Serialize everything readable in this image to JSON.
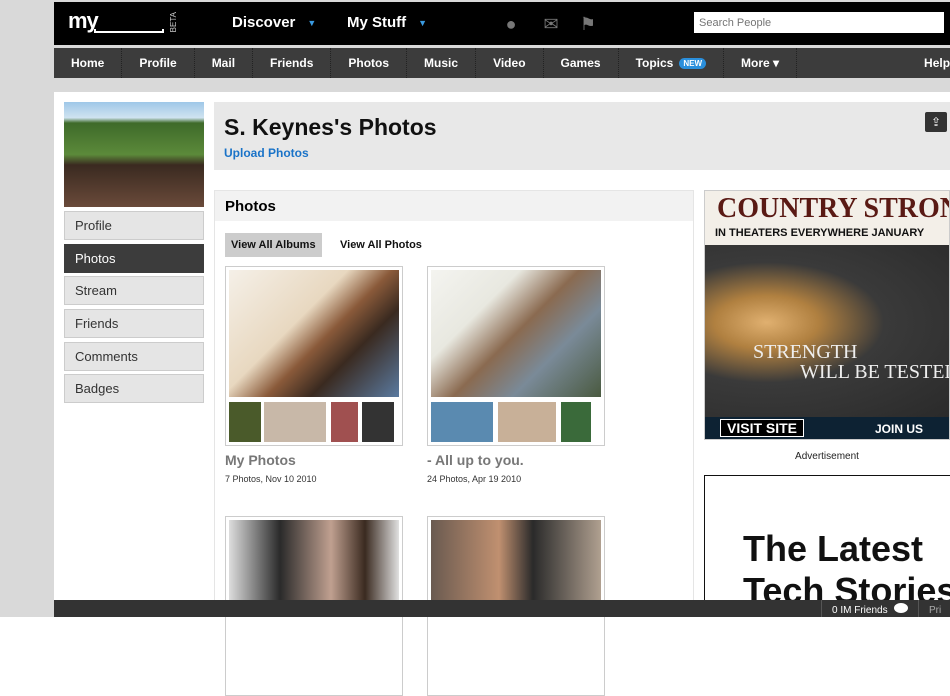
{
  "topbar": {
    "logo": "my",
    "beta": "BETA",
    "discover": "Discover",
    "my_stuff": "My Stuff",
    "search_placeholder": "Search People"
  },
  "nav": {
    "items": [
      "Home",
      "Profile",
      "Mail",
      "Friends",
      "Photos",
      "Music",
      "Video",
      "Games",
      "Topics",
      "More ▾"
    ],
    "new_badge": "NEW",
    "help": "Help"
  },
  "sidebar": {
    "items": [
      "Profile",
      "Photos",
      "Stream",
      "Friends",
      "Comments",
      "Badges"
    ],
    "active": "Photos"
  },
  "header": {
    "title": "S. Keynes's Photos",
    "upload": "Upload Photos"
  },
  "panel": {
    "title": "Photos",
    "tabs": [
      "View All Albums",
      "View All Photos"
    ],
    "albums": [
      {
        "title": "My Photos",
        "meta": "7 Photos, Nov 10 2010"
      },
      {
        "title": "- All up to you.",
        "meta": "24 Photos, Apr 19 2010"
      }
    ]
  },
  "ad1": {
    "line1": "COUNTRY STRONG",
    "line2": "IN THEATERS EVERYWHERE JANUARY",
    "line3": "STRENGTH",
    "line4": "WILL BE TESTED",
    "visit": "VISIT SITE",
    "join": "JOIN US"
  },
  "ad_label": "Advertisement",
  "ad2": {
    "line1": "The Latest",
    "line2": "Tech Stories"
  },
  "footer": {
    "im": "0 IM Friends",
    "pri": "Pri"
  }
}
